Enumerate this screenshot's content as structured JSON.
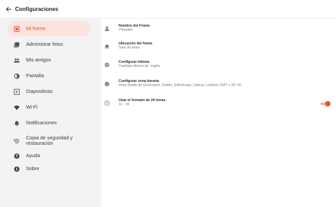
{
  "header": {
    "title": "Configuraciones",
    "back_icon": "arrow-left-icon"
  },
  "colors": {
    "accent": "#e8533b",
    "active_bg": "#fbe3de",
    "sidebar_bg": "#f3f3f3"
  },
  "sidebar": {
    "items": [
      {
        "label": "Mi frame",
        "icon": "frame-icon",
        "active": true
      },
      {
        "label": "Administrar fotos",
        "icon": "photos-icon"
      },
      {
        "label": "Mis amigos",
        "icon": "friends-icon"
      },
      {
        "label": "Pantalla",
        "icon": "brightness-icon"
      },
      {
        "label": "Diapositivas",
        "icon": "slideshow-icon"
      },
      {
        "label": "Wi-Fi",
        "icon": "wifi-icon"
      },
      {
        "label": "Notificaciones",
        "icon": "notifications-icon"
      },
      {
        "label": "Copia de seguridad y restauración",
        "icon": "backup-icon"
      },
      {
        "label": "Ayuda",
        "icon": "help-icon"
      },
      {
        "label": "Sobre",
        "icon": "info-icon"
      }
    ]
  },
  "settings": [
    {
      "title": "Nombre del Frame",
      "value": "Yhenake",
      "icon": "person-icon"
    },
    {
      "title": "Ubicación del frame",
      "value": "Sala de estar",
      "icon": "home-icon"
    },
    {
      "title": "Configurar idioma",
      "value": "Cambiar idioma de: Inglés",
      "icon": "globe-icon"
    },
    {
      "title": "Configurar zona horaria",
      "value": "Hora media de Greenwich: Dublin, Edimburgo, Lisboa, Londres GMT + 00: 00",
      "icon": "globe-clock-icon"
    },
    {
      "title": "Usar el formato de 24 horas",
      "value": "11 : 34",
      "icon": "clock-icon",
      "toggle": true
    }
  ]
}
